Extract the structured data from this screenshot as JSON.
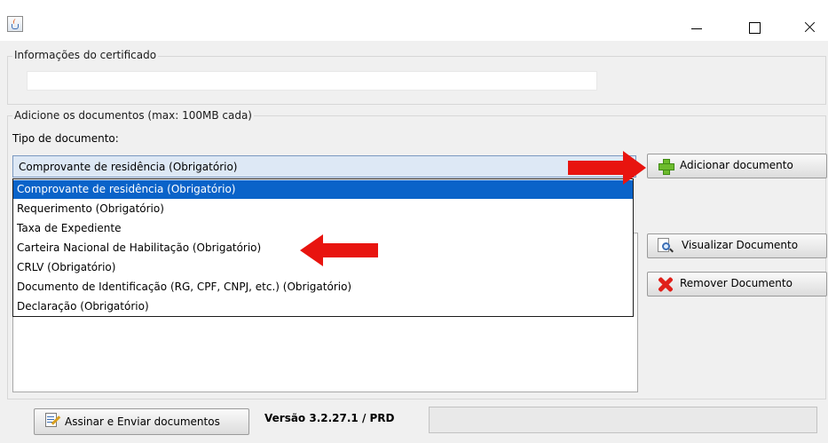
{
  "window": {
    "icon": "java-cup-icon"
  },
  "certificate": {
    "group_label": "Informações do certificado",
    "value": ""
  },
  "documents": {
    "group_label": "Adicione os  documentos (max: 100MB cada)",
    "tipo_label": "Tipo de documento:",
    "selected_value": "Comprovante de residência (Obrigatório)",
    "options": [
      "Comprovante de residência (Obrigatório)",
      "Requerimento (Obrigatório)",
      "Taxa de Expediente",
      "Carteira Nacional de Habilitação (Obrigatório)",
      "CRLV (Obrigatório)",
      "Documento de Identificação (RG, CPF, CNPJ, etc.) (Obrigatório)",
      "Declaração (Obrigatório)"
    ],
    "add_button": "Adicionar documento",
    "view_button": "Visualizar Documento",
    "remove_button": "Remover Documento"
  },
  "footer": {
    "sign_button": "Assinar e Enviar documentos",
    "version": "Versão 3.2.27.1 / PRD",
    "status": ""
  },
  "annotations": {
    "arrow_color": "#e8140f"
  },
  "colors": {
    "selection": "#0a63c9",
    "combo_bg": "#dde8f5"
  }
}
